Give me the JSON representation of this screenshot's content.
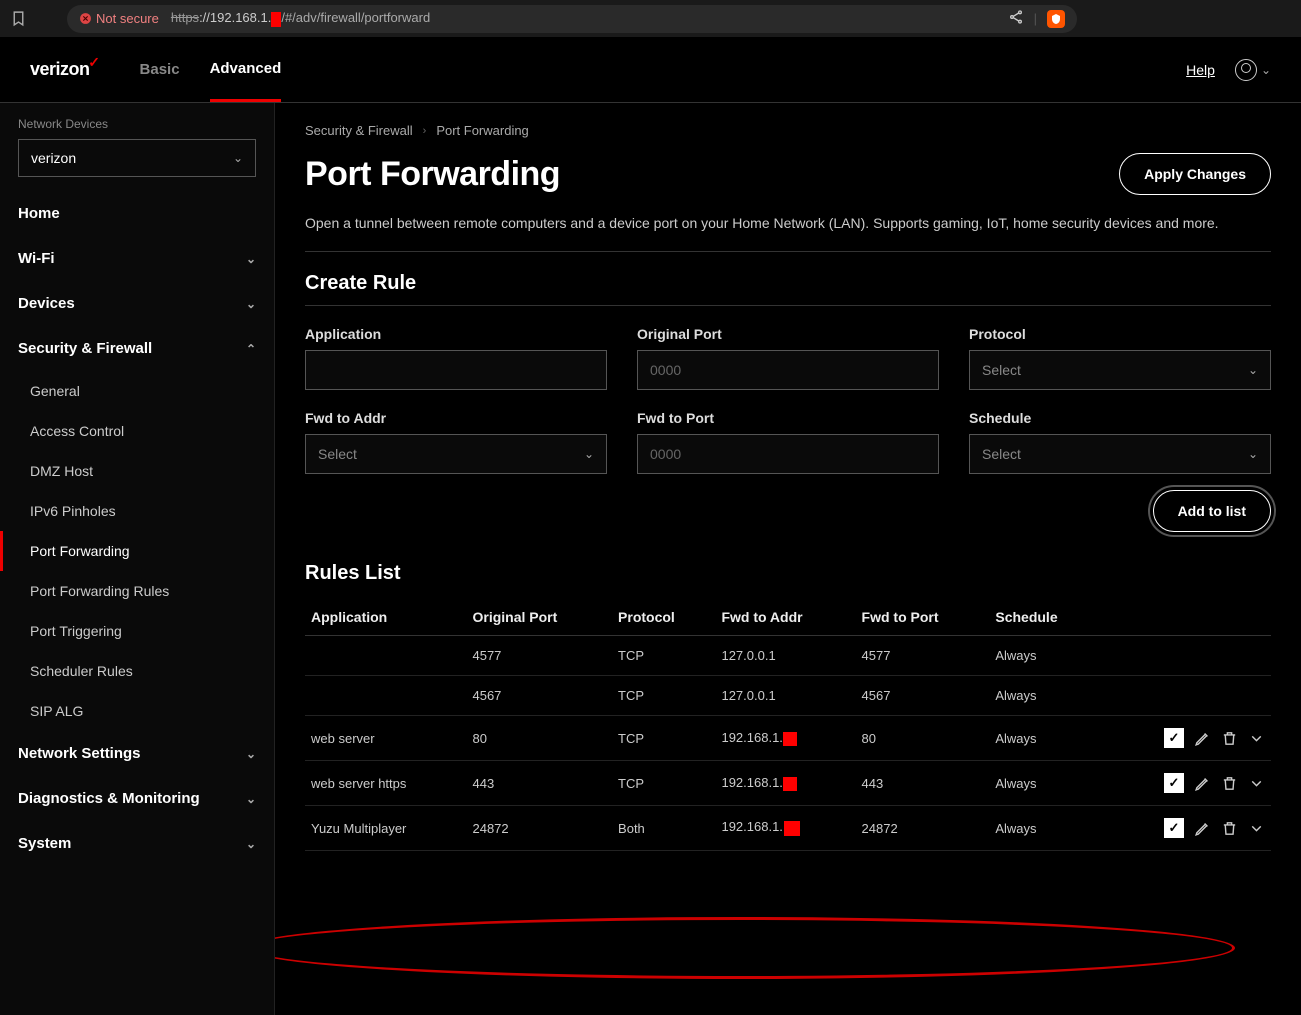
{
  "browser": {
    "not_secure": "Not secure",
    "url_scheme": "https",
    "url_host": "://192.168.1.",
    "url_path": "/#/adv/firewall/portforward"
  },
  "header": {
    "logo": "verizon",
    "tab_basic": "Basic",
    "tab_advanced": "Advanced",
    "help": "Help"
  },
  "sidebar": {
    "section_label": "Network Devices",
    "device_selected": "verizon",
    "items": {
      "home": "Home",
      "wifi": "Wi-Fi",
      "devices": "Devices",
      "security": "Security & Firewall",
      "network_settings": "Network Settings",
      "diagnostics": "Diagnostics & Monitoring",
      "system": "System"
    },
    "security_sub": {
      "general": "General",
      "access_control": "Access Control",
      "dmz": "DMZ Host",
      "ipv6": "IPv6 Pinholes",
      "port_forwarding": "Port Forwarding",
      "port_forwarding_rules": "Port Forwarding Rules",
      "port_triggering": "Port Triggering",
      "scheduler": "Scheduler Rules",
      "sip": "SIP ALG"
    }
  },
  "breadcrumb": {
    "a": "Security & Firewall",
    "b": "Port Forwarding"
  },
  "page": {
    "title": "Port Forwarding",
    "apply": "Apply Changes",
    "description": "Open a tunnel between remote computers and a device port on your Home Network (LAN). Supports gaming, IoT, home security devices and more."
  },
  "create_rule": {
    "title": "Create Rule",
    "application": "Application",
    "original_port": "Original Port",
    "original_port_ph": "0000",
    "protocol": "Protocol",
    "protocol_ph": "Select",
    "fwd_addr": "Fwd to Addr",
    "fwd_addr_ph": "Select",
    "fwd_port": "Fwd to Port",
    "fwd_port_ph": "0000",
    "schedule": "Schedule",
    "schedule_ph": "Select",
    "add": "Add to list"
  },
  "rules": {
    "title": "Rules List",
    "columns": {
      "app": "Application",
      "orig": "Original Port",
      "proto": "Protocol",
      "addr": "Fwd to Addr",
      "port": "Fwd to Port",
      "sched": "Schedule"
    },
    "rows": [
      {
        "app": "",
        "orig": "4577",
        "proto": "TCP",
        "addr": "127.0.0.1",
        "addr_mask": false,
        "port": "4577",
        "sched": "Always",
        "actions": false
      },
      {
        "app": "",
        "orig": "4567",
        "proto": "TCP",
        "addr": "127.0.0.1",
        "addr_mask": false,
        "port": "4567",
        "sched": "Always",
        "actions": false
      },
      {
        "app": "web server",
        "orig": "80",
        "proto": "TCP",
        "addr": "192.168.1.",
        "addr_mask": true,
        "port": "80",
        "sched": "Always",
        "actions": true
      },
      {
        "app": "web server https",
        "orig": "443",
        "proto": "TCP",
        "addr": "192.168.1.",
        "addr_mask": true,
        "port": "443",
        "sched": "Always",
        "actions": true
      },
      {
        "app": "Yuzu Multiplayer",
        "orig": "24872",
        "proto": "Both",
        "addr": "192.168.1.",
        "addr_mask": true,
        "port": "24872",
        "sched": "Always",
        "actions": true
      }
    ]
  }
}
